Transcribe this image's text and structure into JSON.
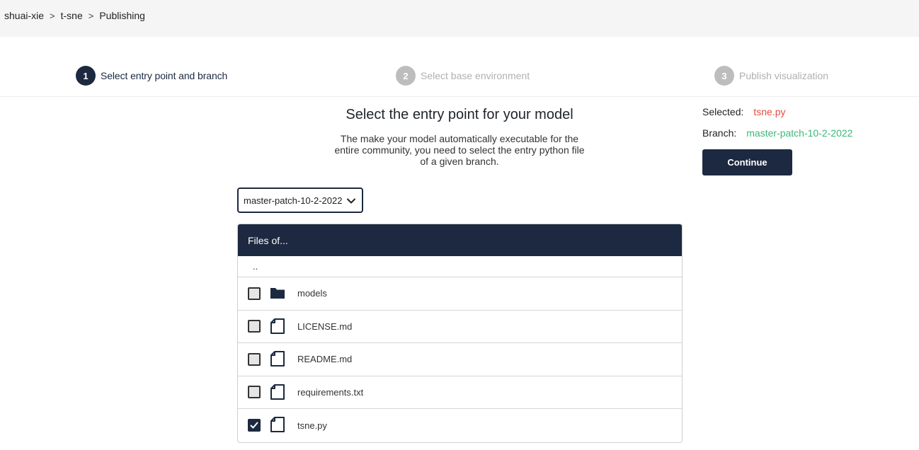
{
  "breadcrumb": {
    "items": [
      "shuai-xie",
      "t-sne",
      "Publishing"
    ],
    "separator": ">"
  },
  "stepper": {
    "steps": [
      {
        "number": "1",
        "label": "Select entry point and branch",
        "state": "active"
      },
      {
        "number": "2",
        "label": "Select base environment",
        "state": "inactive"
      },
      {
        "number": "3",
        "label": "Publish visualization",
        "state": "inactive"
      }
    ]
  },
  "main": {
    "title": "Select the entry point for your model",
    "description": "The make your model automatically executable for the entire community, you need to select the entry python file of a given branch.",
    "branch_select": {
      "value": "master-patch-10-2-2022",
      "icon": "chevron-down-icon"
    }
  },
  "files": {
    "header": "Files of...",
    "up_dir": "..",
    "rows": [
      {
        "name": "models",
        "type": "folder",
        "icon": "folder-icon",
        "checked": false
      },
      {
        "name": "LICENSE.md",
        "type": "file",
        "icon": "file-icon",
        "checked": false
      },
      {
        "name": "README.md",
        "type": "file",
        "icon": "file-icon",
        "checked": false
      },
      {
        "name": "requirements.txt",
        "type": "file",
        "icon": "file-icon",
        "checked": false
      },
      {
        "name": "tsne.py",
        "type": "file",
        "icon": "file-icon",
        "checked": true
      }
    ]
  },
  "summary": {
    "selected_label": "Selected:",
    "selected_value": "tsne.py",
    "branch_label": "Branch:",
    "branch_value": "master-patch-10-2-2022",
    "continue_label": "Continue"
  },
  "colors": {
    "navy": "#1c2940",
    "selected_red": "#e74c3c",
    "branch_green": "#3cb878",
    "inactive_gray": "#bdbdbd"
  }
}
